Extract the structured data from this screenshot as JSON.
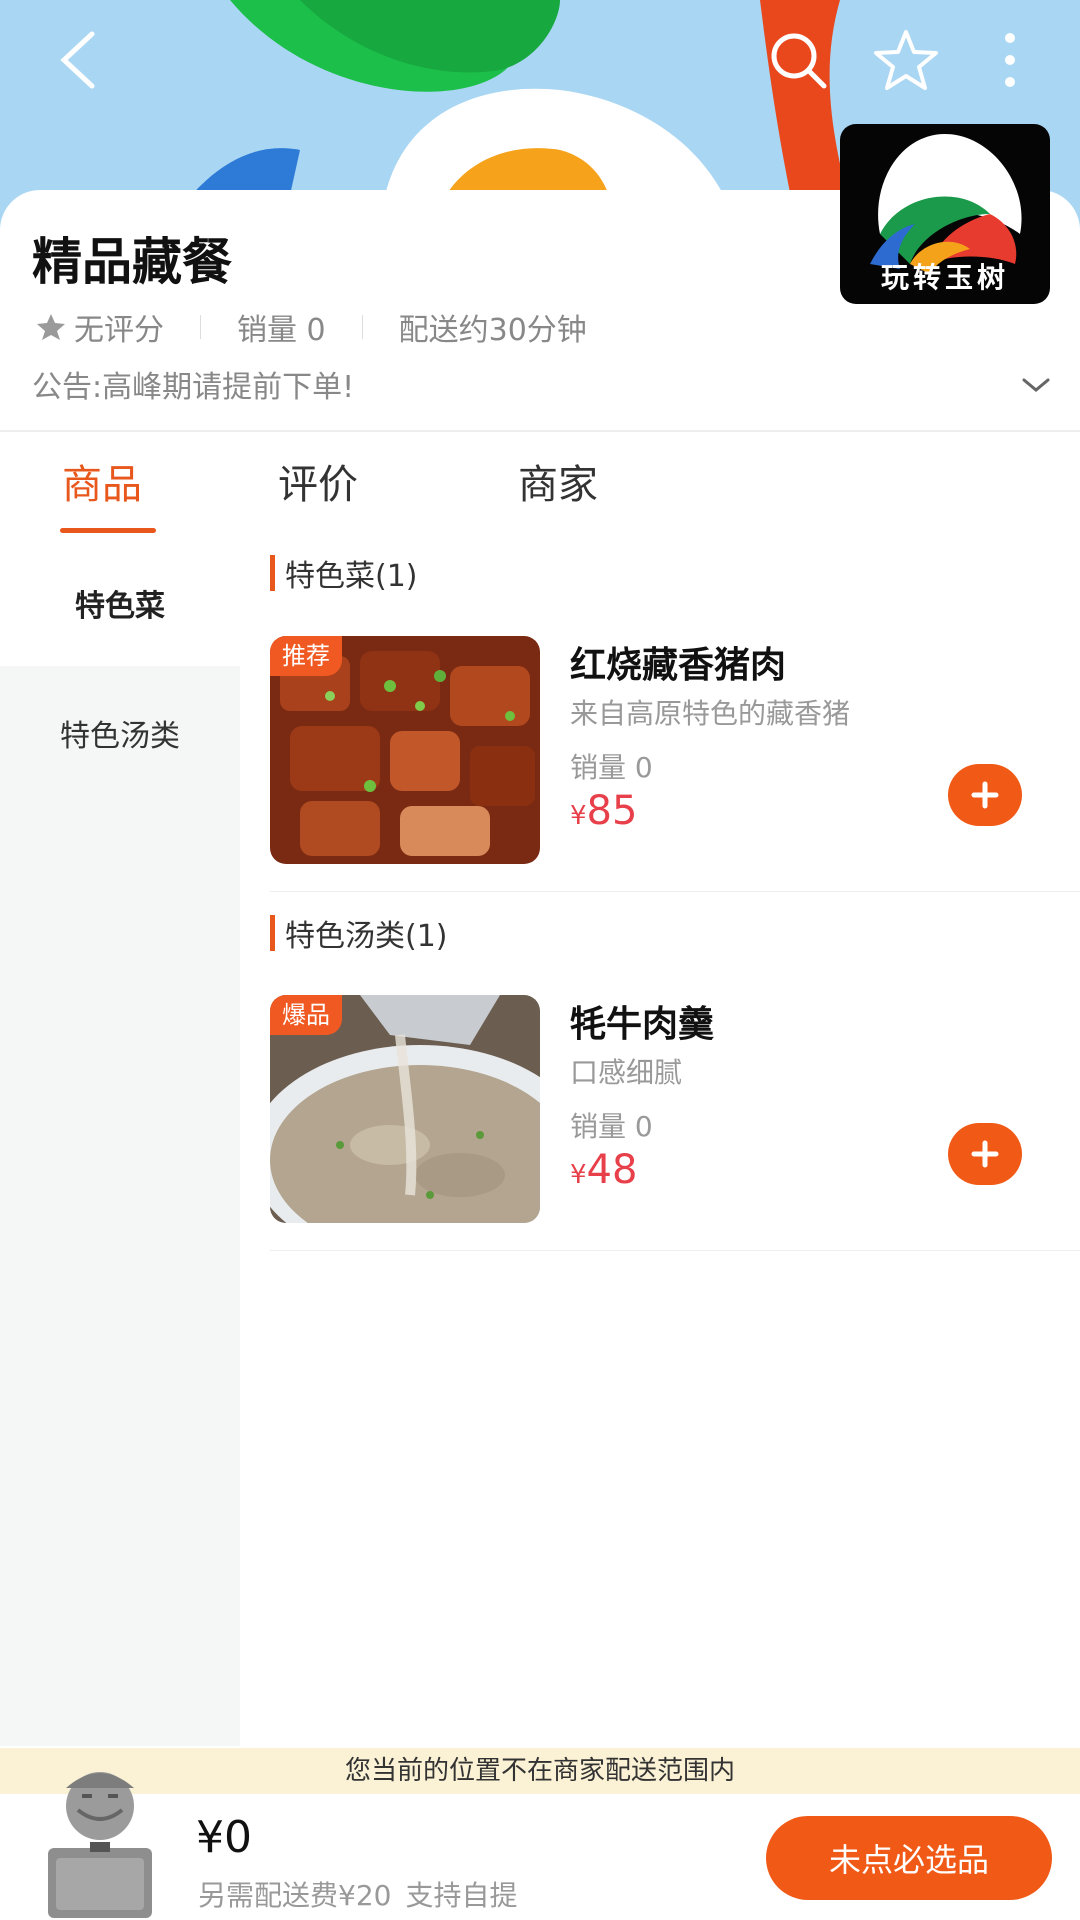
{
  "shop": {
    "name": "精品藏餐",
    "logo_text": "玩转玉树",
    "rating": "无评分",
    "sales": "销量 0",
    "delivery_time": "配送约30分钟",
    "notice": "公告:高峰期请提前下单!"
  },
  "tabs": [
    {
      "label": "商品",
      "active": true
    },
    {
      "label": "评价",
      "active": false
    },
    {
      "label": "商家",
      "active": false
    }
  ],
  "sidebar": {
    "items": [
      {
        "label": "特色菜",
        "active": true
      },
      {
        "label": "特色汤类",
        "active": false
      }
    ]
  },
  "sections": [
    {
      "title": "特色菜(1)",
      "product": {
        "badge": "推荐",
        "name": "红烧藏香猪肉",
        "desc": "来自高原特色的藏香猪",
        "sales": "销量 0",
        "currency": "¥",
        "price": "85"
      }
    },
    {
      "title": "特色汤类(1)",
      "product": {
        "badge": "爆品",
        "name": "牦牛肉羹",
        "desc": "口感细腻",
        "sales": "销量 0",
        "currency": "¥",
        "price": "48"
      }
    }
  ],
  "cart": {
    "range_notice": "您当前的位置不在商家配送范围内",
    "total": "¥0",
    "delivery_fee": "另需配送费¥20",
    "pickup": "支持自提",
    "checkout_label": "未点必选品"
  },
  "colors": {
    "accent": "#f15a16",
    "price": "#e8404a",
    "notice_bg": "#fbf2d6"
  },
  "icons": [
    "back-icon",
    "search-icon",
    "star-icon",
    "more-icon",
    "chevron-down-icon",
    "plus-icon"
  ]
}
